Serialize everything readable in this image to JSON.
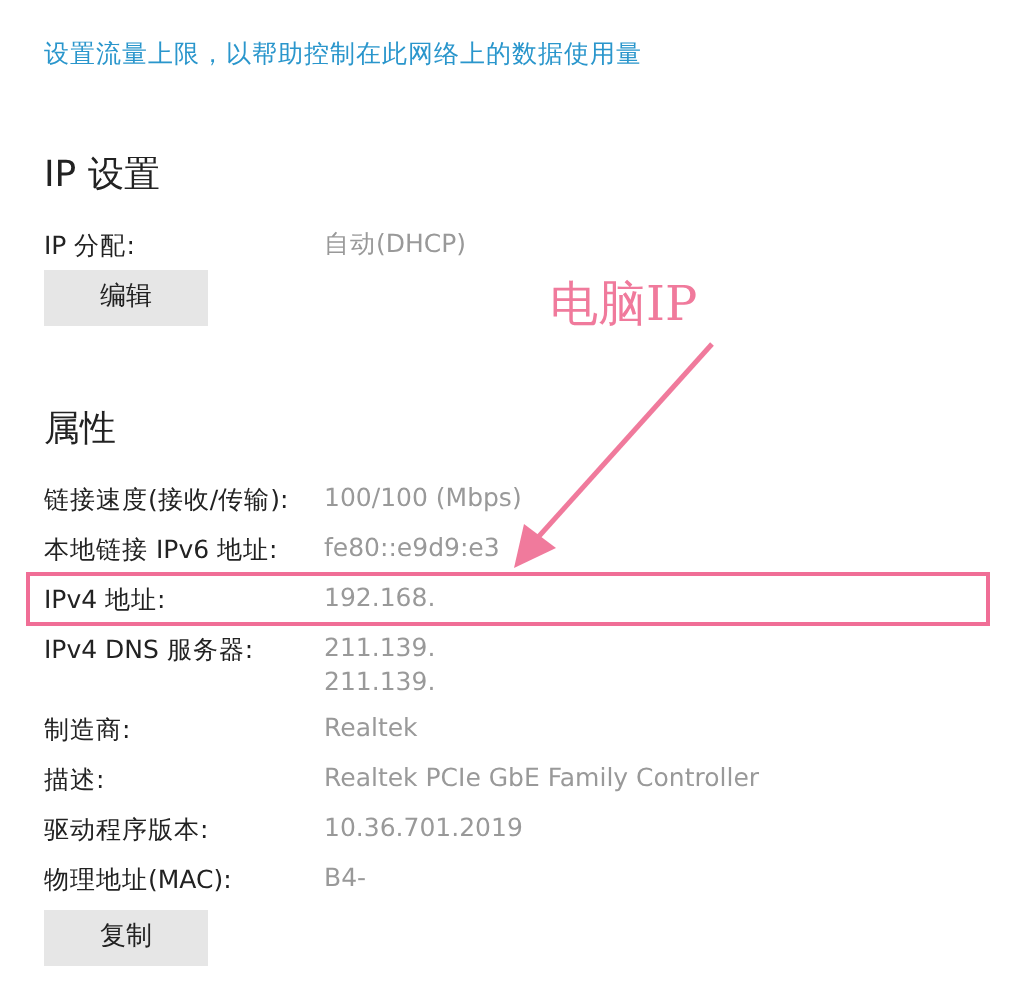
{
  "data_limit_link": "设置流量上限，以帮助控制在此网络上的数据使用量",
  "ip_settings": {
    "heading": "IP 设置",
    "rows": [
      {
        "label": "IP 分配:",
        "values": [
          "自动(DHCP)"
        ]
      }
    ],
    "button": "编辑"
  },
  "properties": {
    "heading": "属性",
    "rows": [
      {
        "label": "链接速度(接收/传输):",
        "values": [
          "100/100 (Mbps)"
        ],
        "highlighted": false
      },
      {
        "label": "本地链接 IPv6 地址:",
        "values": [
          "fe80::e9d9:e3"
        ],
        "highlighted": false
      },
      {
        "label": "IPv4 地址:",
        "values": [
          "192.168."
        ],
        "highlighted": true
      },
      {
        "label": "IPv4 DNS 服务器:",
        "values": [
          "211.139.",
          "211.139."
        ],
        "highlighted": false
      },
      {
        "label": "制造商:",
        "values": [
          "Realtek"
        ],
        "highlighted": false
      },
      {
        "label": "描述:",
        "values": [
          "Realtek PCIe GbE Family Controller"
        ],
        "highlighted": false
      },
      {
        "label": "驱动程序版本:",
        "values": [
          "10.36.701.2019"
        ],
        "highlighted": false
      },
      {
        "label": "物理地址(MAC):",
        "values": [
          "B4-"
        ],
        "highlighted": false
      }
    ],
    "button": "复制"
  },
  "annotation": {
    "label": "电脑IP"
  }
}
